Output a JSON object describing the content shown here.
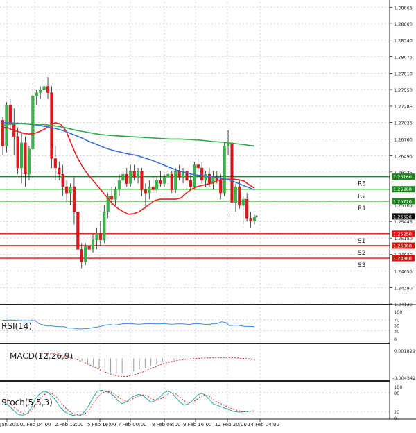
{
  "chart_data": [
    {
      "type": "candlestick",
      "title": "",
      "price_ticks": [
        "1.28865",
        "1.28600",
        "1.28340",
        "1.28075",
        "1.27810",
        "1.27550",
        "1.27285",
        "1.27025",
        "1.26760",
        "1.26495",
        "1.26235",
        "1.25705",
        "1.25445",
        "1.25180",
        "1.24920",
        "1.24655",
        "1.24390",
        "1.24130"
      ],
      "ylim": [
        1.2413,
        1.2889
      ],
      "x_ticks": [
        "Jan 20:00",
        "1 Feb 04:00",
        "2 Feb 12:00",
        "5 Feb 16:00",
        "7 Feb 00:00",
        "8 Feb 08:00",
        "9 Feb 16:00",
        "12 Feb 20:00",
        "14 Feb 04:00"
      ],
      "current_price": "1.25526",
      "candles": [
        [
          1.2706,
          1.2712,
          1.265,
          1.2665
        ],
        [
          1.2665,
          1.2735,
          1.2655,
          1.273
        ],
        [
          1.273,
          1.274,
          1.269,
          1.27
        ],
        [
          1.27,
          1.2725,
          1.265,
          1.268
        ],
        [
          1.268,
          1.2695,
          1.262,
          1.263
        ],
        [
          1.263,
          1.2685,
          1.2605,
          1.267
        ],
        [
          1.267,
          1.268,
          1.26,
          1.262
        ],
        [
          1.262,
          1.2665,
          1.261,
          1.266
        ],
        [
          1.266,
          1.276,
          1.265,
          1.2745
        ],
        [
          1.2745,
          1.2755,
          1.273,
          1.275
        ],
        [
          1.275,
          1.276,
          1.274,
          1.2755
        ],
        [
          1.2755,
          1.277,
          1.2745,
          1.276
        ],
        [
          1.276,
          1.2775,
          1.274,
          1.275
        ],
        [
          1.275,
          1.276,
          1.263,
          1.2645
        ],
        [
          1.2645,
          1.2665,
          1.261,
          1.263
        ],
        [
          1.263,
          1.264,
          1.261,
          1.262
        ],
        [
          1.262,
          1.2635,
          1.2585,
          1.26
        ],
        [
          1.26,
          1.261,
          1.2575,
          1.259
        ],
        [
          1.259,
          1.2605,
          1.257,
          1.26
        ],
        [
          1.26,
          1.2615,
          1.254,
          1.256
        ],
        [
          1.256,
          1.257,
          1.249,
          1.25
        ],
        [
          1.25,
          1.251,
          1.247,
          1.248
        ],
        [
          1.248,
          1.251,
          1.2475,
          1.2505
        ],
        [
          1.2505,
          1.252,
          1.249,
          1.25
        ],
        [
          1.25,
          1.2525,
          1.2495,
          1.2515
        ],
        [
          1.2515,
          1.2535,
          1.25,
          1.2525
        ],
        [
          1.2525,
          1.2545,
          1.2505,
          1.2515
        ],
        [
          1.2515,
          1.257,
          1.251,
          1.256
        ],
        [
          1.256,
          1.259,
          1.255,
          1.2585
        ],
        [
          1.2585,
          1.26,
          1.257,
          1.258
        ],
        [
          1.258,
          1.26,
          1.257,
          1.2595
        ],
        [
          1.2595,
          1.262,
          1.2585,
          1.261
        ],
        [
          1.261,
          1.263,
          1.2595,
          1.262
        ],
        [
          1.262,
          1.263,
          1.26,
          1.2605
        ],
        [
          1.2605,
          1.2635,
          1.26,
          1.2625
        ],
        [
          1.2625,
          1.2635,
          1.261,
          1.2615
        ],
        [
          1.2615,
          1.263,
          1.2605,
          1.2625
        ],
        [
          1.2625,
          1.263,
          1.2585,
          1.2595
        ],
        [
          1.2595,
          1.2605,
          1.2565,
          1.259
        ],
        [
          1.259,
          1.261,
          1.258,
          1.26
        ],
        [
          1.26,
          1.2615,
          1.259,
          1.2595
        ],
        [
          1.2595,
          1.2615,
          1.259,
          1.261
        ],
        [
          1.261,
          1.2625,
          1.26,
          1.2605
        ],
        [
          1.2605,
          1.262,
          1.26,
          1.2615
        ],
        [
          1.2615,
          1.263,
          1.2605,
          1.262
        ],
        [
          1.262,
          1.2625,
          1.259,
          1.2595
        ],
        [
          1.2595,
          1.263,
          1.259,
          1.2625
        ],
        [
          1.2625,
          1.2635,
          1.261,
          1.2615
        ],
        [
          1.2615,
          1.263,
          1.2605,
          1.2625
        ],
        [
          1.2625,
          1.263,
          1.26,
          1.261
        ],
        [
          1.261,
          1.262,
          1.2595,
          1.26
        ],
        [
          1.26,
          1.264,
          1.2595,
          1.2635
        ],
        [
          1.2635,
          1.2645,
          1.2625,
          1.263
        ],
        [
          1.263,
          1.264,
          1.2605,
          1.261
        ],
        [
          1.261,
          1.2625,
          1.26,
          1.262
        ],
        [
          1.262,
          1.263,
          1.26,
          1.2605
        ],
        [
          1.2605,
          1.2625,
          1.2595,
          1.2615
        ],
        [
          1.2615,
          1.2625,
          1.2605,
          1.261
        ],
        [
          1.261,
          1.262,
          1.258,
          1.259
        ],
        [
          1.259,
          1.267,
          1.2585,
          1.2665
        ],
        [
          1.2665,
          1.269,
          1.265,
          1.267
        ],
        [
          1.267,
          1.268,
          1.256,
          1.2575
        ],
        [
          1.2575,
          1.2605,
          1.256,
          1.26
        ],
        [
          1.26,
          1.261,
          1.2565,
          1.257
        ],
        [
          1.257,
          1.2585,
          1.254,
          1.258
        ],
        [
          1.258,
          1.259,
          1.2545,
          1.255
        ],
        [
          1.255,
          1.256,
          1.2535,
          1.2545
        ],
        [
          1.2545,
          1.2555,
          1.254,
          1.2552
        ]
      ],
      "moving_averages": [
        {
          "name": "MA fast",
          "color": "#e8231f",
          "values": [
            1.2695,
            1.2694,
            1.269,
            1.2688,
            1.2685,
            1.2684,
            1.2685,
            1.2688,
            1.2692,
            1.2698,
            1.2702,
            1.27,
            1.269,
            1.267,
            1.265,
            1.2635,
            1.2622,
            1.2612,
            1.2602,
            1.2592,
            1.2582,
            1.2572,
            1.2565,
            1.256,
            1.2556,
            1.2557,
            1.256,
            1.2566,
            1.2572,
            1.2578,
            1.258,
            1.258,
            1.258,
            1.258,
            1.2582,
            1.259,
            1.2596,
            1.26,
            1.2602,
            1.2604,
            1.2606,
            1.261,
            1.2612,
            1.2612,
            1.2612,
            1.2611,
            1.2609,
            1.2603,
            1.2598
          ]
        },
        {
          "name": "MA medium",
          "color": "#3b6fd6",
          "values": [
            1.2702,
            1.2702,
            1.2701,
            1.27,
            1.2699,
            1.2697,
            1.2695,
            1.2692,
            1.2688,
            1.2683,
            1.2678,
            1.2672,
            1.2667,
            1.2662,
            1.2658,
            1.2655,
            1.2652,
            1.265,
            1.2646,
            1.2642,
            1.2637,
            1.2632,
            1.2627,
            1.2623,
            1.262,
            1.2618,
            1.2617,
            1.2615,
            1.2613,
            1.261,
            1.2605,
            1.26,
            1.2595
          ]
        },
        {
          "name": "MA slow",
          "color": "#2faa4a",
          "values": [
            1.2698,
            1.27,
            1.2701,
            1.27,
            1.2699,
            1.2697,
            1.2694,
            1.269,
            1.2687,
            1.2684,
            1.2682,
            1.2681,
            1.268,
            1.2679,
            1.2678,
            1.2677,
            1.2676,
            1.2676,
            1.2675,
            1.2674,
            1.2672,
            1.2671,
            1.2669,
            1.2667,
            1.2665
          ]
        }
      ],
      "levels": [
        {
          "label": "R3",
          "value": "1.26160",
          "v": 1.2616,
          "color": "#1e8a1e"
        },
        {
          "label": "R2",
          "value": "1.25960",
          "v": 1.2596,
          "color": "#1e8a1e"
        },
        {
          "label": "R1",
          "value": "1.25770",
          "v": 1.2577,
          "color": "#1e8a1e"
        },
        {
          "label": "S1",
          "value": "1.25250",
          "v": 1.2525,
          "color": "#e01010"
        },
        {
          "label": "S2",
          "value": "1.25060",
          "v": 1.2506,
          "color": "#e01010"
        },
        {
          "label": "S3",
          "value": "1.24860",
          "v": 1.2486,
          "color": "#e01010"
        }
      ],
      "colors": {
        "up": "#3cb14a",
        "down": "#d7191c",
        "level_tag_up": "#1e8a1e",
        "level_tag_down": "#e01010"
      }
    },
    {
      "type": "line",
      "name": "RSI(14)",
      "ticks": [
        "100",
        "70",
        "50",
        "30",
        "0"
      ],
      "ylim": [
        0,
        100
      ],
      "color": "#3a8ee6",
      "values": [
        68,
        68,
        69,
        68,
        67,
        66,
        66,
        67,
        67,
        55,
        50,
        47,
        47,
        45,
        44,
        44,
        39,
        39,
        37,
        36,
        37,
        38,
        41,
        43,
        46,
        50,
        52,
        50,
        52,
        54,
        56,
        55,
        54,
        53,
        54,
        55,
        56,
        54,
        55,
        56,
        54,
        53,
        54,
        55,
        54,
        52,
        54,
        56,
        55,
        52,
        53,
        55,
        56,
        62,
        60,
        48,
        50,
        49,
        47,
        45,
        45,
        44
      ]
    },
    {
      "type": "bar+line",
      "name": "MACD(12,26,9)",
      "ticks": [
        "0.001829",
        "-0.004542"
      ],
      "ylim": [
        -0.004542,
        0.001829
      ],
      "bar_color": "#9a9a9a",
      "signal_color": "#d7191c",
      "histogram": [
        0.0014,
        0.0013,
        0.0012,
        0.0011,
        0.0008,
        0.0004,
        0.0,
        -0.0006,
        -0.0012,
        -0.0018,
        -0.0024,
        -0.0029,
        -0.0032,
        -0.0034,
        -0.0035,
        -0.0034,
        -0.003,
        -0.0026,
        -0.0022,
        -0.0017,
        -0.0013,
        -0.0009,
        -0.0006,
        -0.0004,
        -0.0002,
        -0.0001,
        0.0,
        0.0001,
        0.0001,
        0.0002,
        0.0002,
        0.0003,
        0.0002,
        0.0002,
        0.0001,
        0.0001,
        -0.0002,
        -0.0005
      ],
      "signal": [
        0.0012,
        0.0011,
        0.001,
        0.0008,
        0.0005,
        0.0002,
        -0.0002,
        -0.0007,
        -0.0013,
        -0.0019,
        -0.0025,
        -0.0031,
        -0.0036,
        -0.004,
        -0.0042,
        -0.0041,
        -0.0038,
        -0.0034,
        -0.0029,
        -0.0023,
        -0.0018,
        -0.0013,
        -0.0009,
        -0.0006,
        -0.0004,
        -0.0002,
        -0.0001,
        0.0,
        0.0001,
        0.0001,
        0.0002,
        0.0002,
        0.0002,
        0.0002,
        0.0001,
        0.0,
        -0.0001,
        -0.0003
      ]
    },
    {
      "type": "line",
      "name": "Stoch(5,5,3)",
      "ticks": [
        "100",
        "80",
        "20",
        "0"
      ],
      "ylim": [
        0,
        100
      ],
      "main_color": "#2aa9a1",
      "signal_color": "#d7191c",
      "main": [
        50,
        45,
        35,
        20,
        10,
        8,
        12,
        30,
        60,
        75,
        85,
        82,
        70,
        55,
        35,
        20,
        12,
        8,
        6,
        8,
        20,
        40,
        65,
        85,
        88,
        85,
        80,
        70,
        55,
        45,
        50,
        62,
        70,
        75,
        72,
        60,
        50,
        55,
        65,
        78,
        86,
        80,
        65,
        50,
        40,
        45,
        55,
        70,
        78,
        74,
        60,
        45,
        40,
        35,
        30,
        25,
        20,
        18,
        18,
        20,
        21,
        22
      ],
      "signal": [
        58,
        52,
        45,
        32,
        22,
        14,
        12,
        20,
        40,
        58,
        72,
        80,
        78,
        68,
        52,
        36,
        24,
        14,
        10,
        9,
        12,
        25,
        45,
        64,
        78,
        84,
        84,
        78,
        68,
        58,
        52,
        56,
        64,
        70,
        73,
        70,
        62,
        56,
        58,
        66,
        75,
        80,
        76,
        65,
        54,
        48,
        50,
        58,
        68,
        73,
        70,
        60,
        50,
        44,
        38,
        32,
        27,
        23,
        20,
        19,
        20,
        21
      ]
    }
  ]
}
